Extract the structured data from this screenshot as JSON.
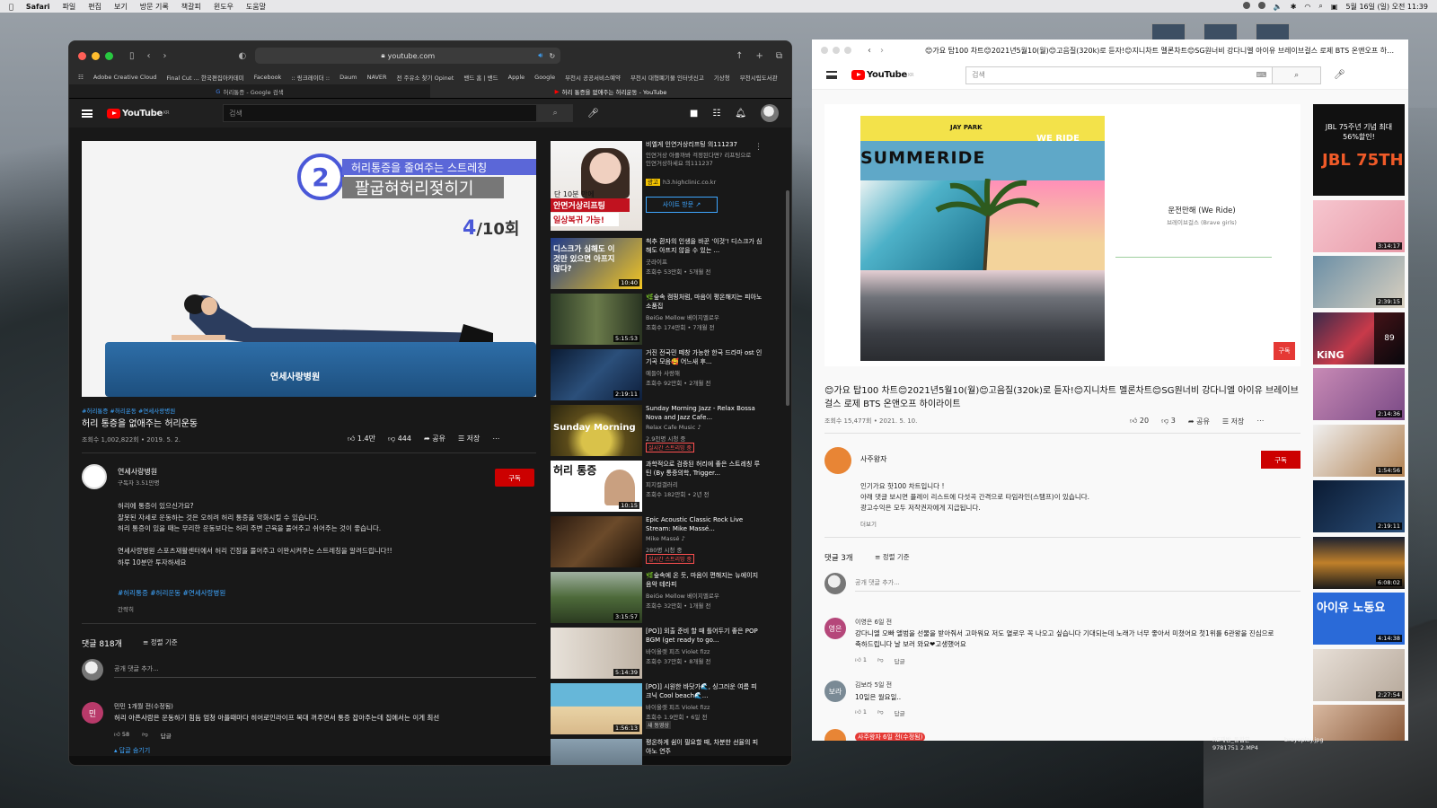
{
  "menubar": {
    "items": [
      "Safari",
      "파일",
      "편집",
      "보기",
      "방문 기록",
      "책갈피",
      "윈도우",
      "도움말"
    ],
    "clock": "5월 16일 (일) 오전 11:39"
  },
  "safari": {
    "url": "youtube.com",
    "bookmarks": [
      "Adobe Creative Cloud",
      "Final Cut ... 한국편집아카데미",
      "Facebook",
      ":: 링크레이더 ::",
      "Daum",
      "NAVER",
      "전 주유소 찾기 Opinet",
      "밴드 홈 | 밴드",
      "Apple",
      "Google",
      "부천시 공공서비스예약",
      "부천시 대형폐기물 인터넷신고",
      "기상청",
      "부천시립도서관"
    ],
    "tabs": [
      "허리통증 - Google 검색",
      "허리 통증을 없애주는 허리운동 - YouTube"
    ],
    "search_placeholder": "검색",
    "video": {
      "overlay_title": "허리통증을 줄여주는 스트레칭",
      "overlay_subtitle": "팔굽혀허리젖히기",
      "overlay_number": "2",
      "overlay_count_num": "4",
      "overlay_count_total": "/10회",
      "overlay_logo": "연세사랑병원",
      "tags": "#허리통증 #허리운동 #연세사랑병원",
      "title": "허리 통증을 없애주는 허리운동",
      "views": "조회수 1,002,822회 • 2019. 5. 2.",
      "likes": "1.4만",
      "dislikes": "444",
      "share": "공유",
      "save": "저장"
    },
    "channel": {
      "name": "연세사랑병원",
      "subs": "구독자 3.51만명",
      "subscribe": "구독"
    },
    "description": [
      "허리에 통증이 있으신가요?",
      "잘못된 자세로 운동하는 것은 오히려 허리 통증을 악화시킬 수 있습니다.",
      " 허리 통증이 있을 때는 무리한 운동보다는 허리 주변 근육을 풀어주고 쉬어주는 것이 좋습니다.",
      "",
      "연세사랑병원 스포츠재활센터에서 허리 긴장을 풀어주고 이완시켜주는 스트레칭을 알려드립니다!!",
      "하루 10분만 투자하세요"
    ],
    "hashtags": "#허리통증 #허리운동 #연세사랑병원",
    "show_less": "간략히",
    "comments": {
      "count": "댓글 818개",
      "sort": "정렬 기준",
      "input": "공개 댓글 추가...",
      "first": {
        "avatar": "민",
        "author": "민민  1개월 전(수정됨)",
        "text": "허리 아픈사람은 운동하기 힘듬 엄청 아플때마다 히어로인라이프 복대 꺼주면서 통증 잡아주는데 집에서는 이게 최선",
        "likes": "58",
        "reply": "답글",
        "hide": "답글 숨기기"
      }
    },
    "ad": {
      "title": "비엘게 인연거상리프팅 의111237",
      "desc": "인연거상 아플까봐 걱정된다면? 리프팅으로 인연거상하세요 의111237",
      "badge": "광고",
      "site": "h3.highclinic.co.kr",
      "button": "사이트 방문",
      "thumb_top": "단 10분 만에",
      "thumb_mid": "안면거상리프팅",
      "thumb_bot": "일상복귀 가능!"
    },
    "sidebar": [
      {
        "title": "척추 환자의 인생을 바꾼 '이것'! 디스크가 심해도 아프지 않을 수 있는 ...",
        "channel": "굿라이프",
        "meta": "조회수 53만회 • 5개월 전",
        "dur": "10:40",
        "thumb": "디스크가 심해도 이것만 있으면 아프지 않다?"
      },
      {
        "title": "🌿숲속 캠핑처럼, 마음이 평온해지는 피아노 소품집",
        "channel": "BeiGe Mellow 베이지멜로우",
        "meta": "조회수 174만회 • 7개월 전",
        "dur": "5:15:53"
      },
      {
        "title": "거진 전국민 떼창 가능한 한국 드라마 ost 인기곡 모음🥰 어느새 후...",
        "channel": "예들아 사랑해",
        "meta": "조회수 92만회 • 2개월 전",
        "dur": "2:19:11"
      },
      {
        "title": "Sunday Morning Jazz - Relax Bossa Nova and Jazz Cafe...",
        "channel": "Relax Cafe Music ♪",
        "meta": "2.9천명 시청 중",
        "live": "실시간 스트리밍 중",
        "thumb": "Sunday Morning"
      },
      {
        "title": "과학적으로 검증된 허리에 좋은 스트레칭 루틴 (By 통증의학, Trigger...",
        "channel": "피지컬갤러리",
        "meta": "조회수 182만회 • 2년 전",
        "dur": "10:15",
        "thumb": "허리 통증"
      },
      {
        "title": "Epic Acoustic Classic Rock Live Stream: Mike Massé...",
        "channel": "Mike Massé ♪",
        "meta": "280명 시청 중",
        "live": "실시간 스트리밍 중"
      },
      {
        "title": "🌿숲속에 온 듯, 마음이 편해지는 뉴에이지 음악 테라피",
        "channel": "BeiGe Mellow 베이지멜로우",
        "meta": "조회수 32만회 • 1개월 전",
        "dur": "3:15:57"
      },
      {
        "title": "[PO]] 외출 준비 할 때 틀어두기 좋은 POP BGM (get ready to go...",
        "channel": "바이올렛 피즈 Violet fizz",
        "meta": "조회수 37만회 • 8개월 전",
        "dur": "5:14:39"
      },
      {
        "title": "[PO]] 시원한 바닷가🌊, 싱그러운 여름 피크닉 Cool beach🌊...",
        "channel": "바이올렛 피즈 Violet fizz",
        "meta": "조회수 1.9만회 • 6일 전",
        "dur": "1:56:13",
        "badge": "새 동영상"
      },
      {
        "title": "평온하게 쉼이 필요할 때, 차분한 선율의 피아노 연주",
        "channel": "",
        "meta": ""
      }
    ]
  },
  "window2": {
    "title": "😊가요 탑100 차트😊2021년5월10(월)😊고음질(320k)로 듣자!😊지니차트 멜론차트😊SG원너비 강다니엘 아이유 브레이브걸스 로제 BTS 온앤오프 하이라이트 -",
    "search_placeholder": "검색",
    "album_text": "SUMMERIDE",
    "album_sign": "JAY PARK",
    "album_weride": "WE RIDE",
    "song": "운전만해 (We Ride)",
    "artist": "브레이브걸스 (Brave girls)",
    "sub_small": "구독",
    "video_title": "😊가요 탑100 차트😊2021년5월10(월)😊고음질(320k)로 듣자!😊지니차트 멜론차트😊SG원너비 강다니엘 아이유 브레이브걸스 로제 BTS 온앤오프 하이라이트",
    "views": "조회수 15,477회 • 2021. 5. 10.",
    "likes": "20",
    "dislikes": "3",
    "share": "공유",
    "save": "저장",
    "channel": "사주왕자",
    "subscribe": "구독",
    "desc": [
      "인기가요 핫100 차트입니다 !",
      "아래 댓글 보시면 플레이 리스트에 다섯곡 간격으로 타임라인(스탬프)이 있습니다.",
      "광고수익은 모두 저작권자에게 지급됩니다."
    ],
    "more": "더보기",
    "comments_count": "댓글 3개",
    "sort": "정렬 기준",
    "comment_input": "공개 댓글 추가...",
    "comments": [
      {
        "avatar": "영은",
        "author": "이영은  6일 전",
        "text": "강다니엘 오빠 앨범을 선물을 받아줘서 고마워요 저도 열로우 꼭 나오고 싶습니다 기대되는데 노래가 너무 좋아서 미쳤어요 첫1위를 6관왕을 진심으로 축하드립니다 날 보러 와요❤고생했어요",
        "likes": "1",
        "reply": "답글"
      },
      {
        "avatar": "보라",
        "author": "김보라  5일 전",
        "text": "10일은 월요일..",
        "likes": "1",
        "reply": "답글"
      },
      {
        "avatar": "",
        "author": "사주왕자  6일 전(수정됨)",
        "text": "",
        "likes": "",
        "reply": ""
      }
    ],
    "strip": [
      {
        "text": "JBL 75주년 기념 최대 56%할인!",
        "sub": "JBL 75TH"
      },
      {
        "dur": "3:14:17"
      },
      {
        "dur": "2:39:15"
      },
      {
        "count": "89",
        "sub": "KiNG"
      },
      {
        "dur": "2:14:36"
      },
      {
        "dur": "1:54:56"
      },
      {
        "dur": "2:19:11"
      },
      {
        "dur": "6:08:02"
      },
      {
        "dur": "4:14:38",
        "sub": "아이유 노동요"
      },
      {
        "dur": "2:27:54"
      },
      {
        "dur": ""
      }
    ]
  },
  "desktop": {
    "file1": "9781751 2.MP4",
    "file1_top": "RE재방_통합본",
    "file2": "brayoplay.jpg"
  },
  "colors": {
    "yt_red": "#ff0000",
    "sub_red": "#cc0000",
    "link_blue": "#3ea6ff",
    "overlay_blue": "#5b67d8"
  }
}
